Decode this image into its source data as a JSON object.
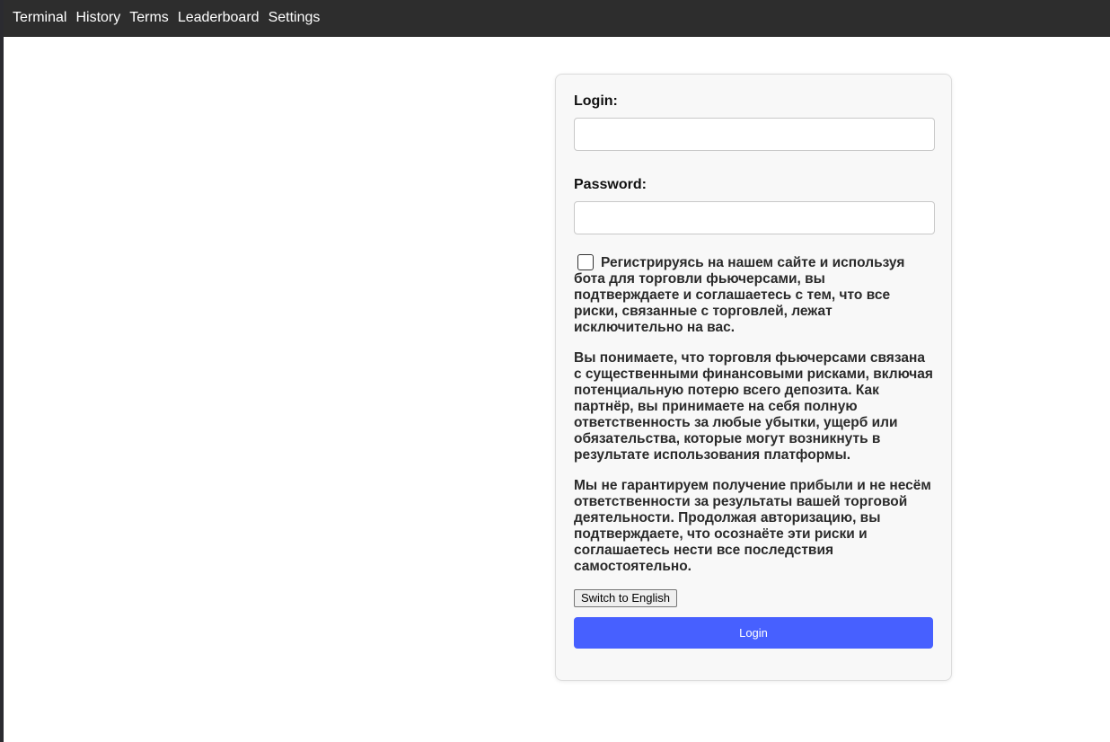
{
  "nav": {
    "items": [
      "Terminal",
      "History",
      "Terms",
      "Leaderboard",
      "Settings"
    ]
  },
  "form": {
    "login_label": "Login:",
    "login_value": "",
    "password_label": "Password:",
    "password_value": "",
    "terms_checked": false,
    "terms_paragraphs": [
      "Регистрируясь на нашем сайте и используя бота для торговли фьючерсами, вы подтверждаете и соглашаетесь с тем, что все риски, связанные с торговлей, лежат исключительно на вас.",
      "Вы понимаете, что торговля фьючерсами связана с существенными финансовыми рисками, включая потенциальную потерю всего депозита. Как партнёр, вы принимаете на себя полную ответственность за любые убытки, ущерб или обязательства, которые могут возникнуть в результате использования платформы.",
      "Мы не гарантируем получение прибыли и не несём ответственности за результаты вашей торговой деятельности. Продолжая авторизацию, вы подтверждаете, что осознаёте эти риски и соглашаетесь нести все последствия самостоятельно."
    ],
    "switch_language_label": "Switch to English",
    "login_button_label": "Login"
  },
  "colors": {
    "navbar_bg": "#2d2d2d",
    "primary_button": "#4760ff",
    "card_bg": "#f8f8f8"
  }
}
